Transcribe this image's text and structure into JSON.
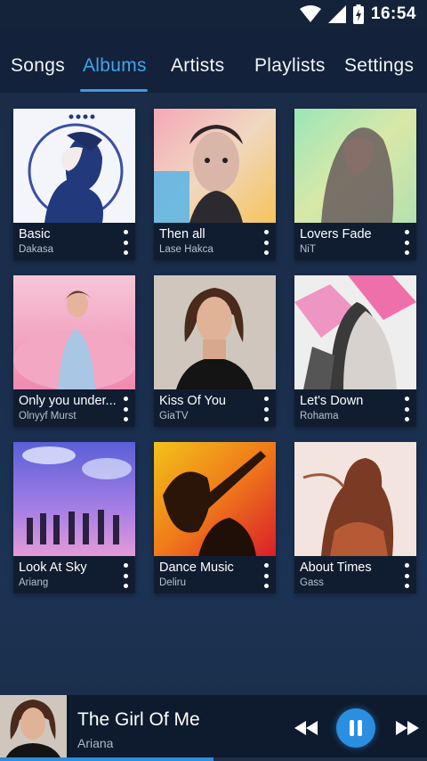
{
  "status_bar": {
    "time": "16:54"
  },
  "tabs": [
    {
      "label": "Songs",
      "active": false
    },
    {
      "label": "Albums",
      "active": true
    },
    {
      "label": "Artists",
      "active": false
    },
    {
      "label": "Playlists",
      "active": false
    },
    {
      "label": "Settings",
      "active": false
    }
  ],
  "albums": [
    {
      "title": "Basic",
      "artist": "Dakasa"
    },
    {
      "title": "Then all",
      "artist": "Lase Hakca"
    },
    {
      "title": "Lovers Fade",
      "artist": "NiT"
    },
    {
      "title": "Only you under...",
      "artist": "Olnyyf Murst"
    },
    {
      "title": "Kiss Of You",
      "artist": "GiaTV"
    },
    {
      "title": "Let's Down",
      "artist": "Rohama"
    },
    {
      "title": "Look At Sky",
      "artist": "Ariang"
    },
    {
      "title": "Dance Music",
      "artist": "Deliru"
    },
    {
      "title": "About Times",
      "artist": "Gass"
    }
  ],
  "now_playing": {
    "title": "The Girl Of Me",
    "artist": "Ariana",
    "state": "playing",
    "progress": 0.5
  },
  "colors": {
    "accent": "#3fa6ee",
    "background": "#1a2e4c",
    "tabbar": "#13213a",
    "card_info": "#101d31"
  }
}
